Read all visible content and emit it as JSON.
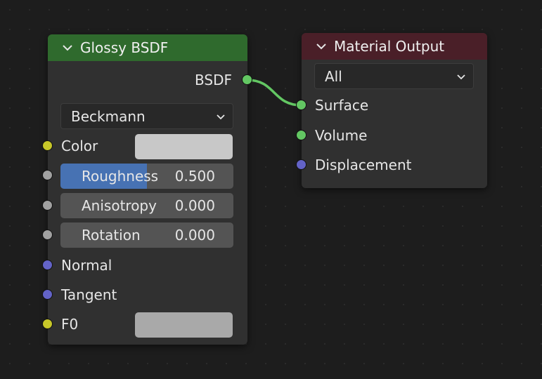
{
  "colors": {
    "background": "#1d1d1d",
    "node_body": "#303030",
    "glossy_header": "#2f6a2d",
    "output_header": "#4a1f28",
    "socket_shader": "#63c763",
    "socket_color": "#c7c729",
    "socket_float": "#a1a1a1",
    "socket_vector": "#6363c7",
    "slider_fill": "#4772b3",
    "link": "#63c763"
  },
  "glossy_node": {
    "title": "Glossy BSDF",
    "output_label": "BSDF",
    "distribution": "Beckmann",
    "inputs": {
      "color_label": "Color",
      "roughness_label": "Roughness",
      "roughness_value": "0.500",
      "roughness_factor": 0.5,
      "anisotropy_label": "Anisotropy",
      "anisotropy_value": "0.000",
      "rotation_label": "Rotation",
      "rotation_value": "0.000",
      "normal_label": "Normal",
      "tangent_label": "Tangent",
      "f0_label": "F0",
      "color_swatch": "#c8c8c8",
      "f0_swatch": "#a9a9a9"
    }
  },
  "output_node": {
    "title": "Material Output",
    "target": "All",
    "inputs": {
      "surface_label": "Surface",
      "volume_label": "Volume",
      "displacement_label": "Displacement"
    }
  }
}
